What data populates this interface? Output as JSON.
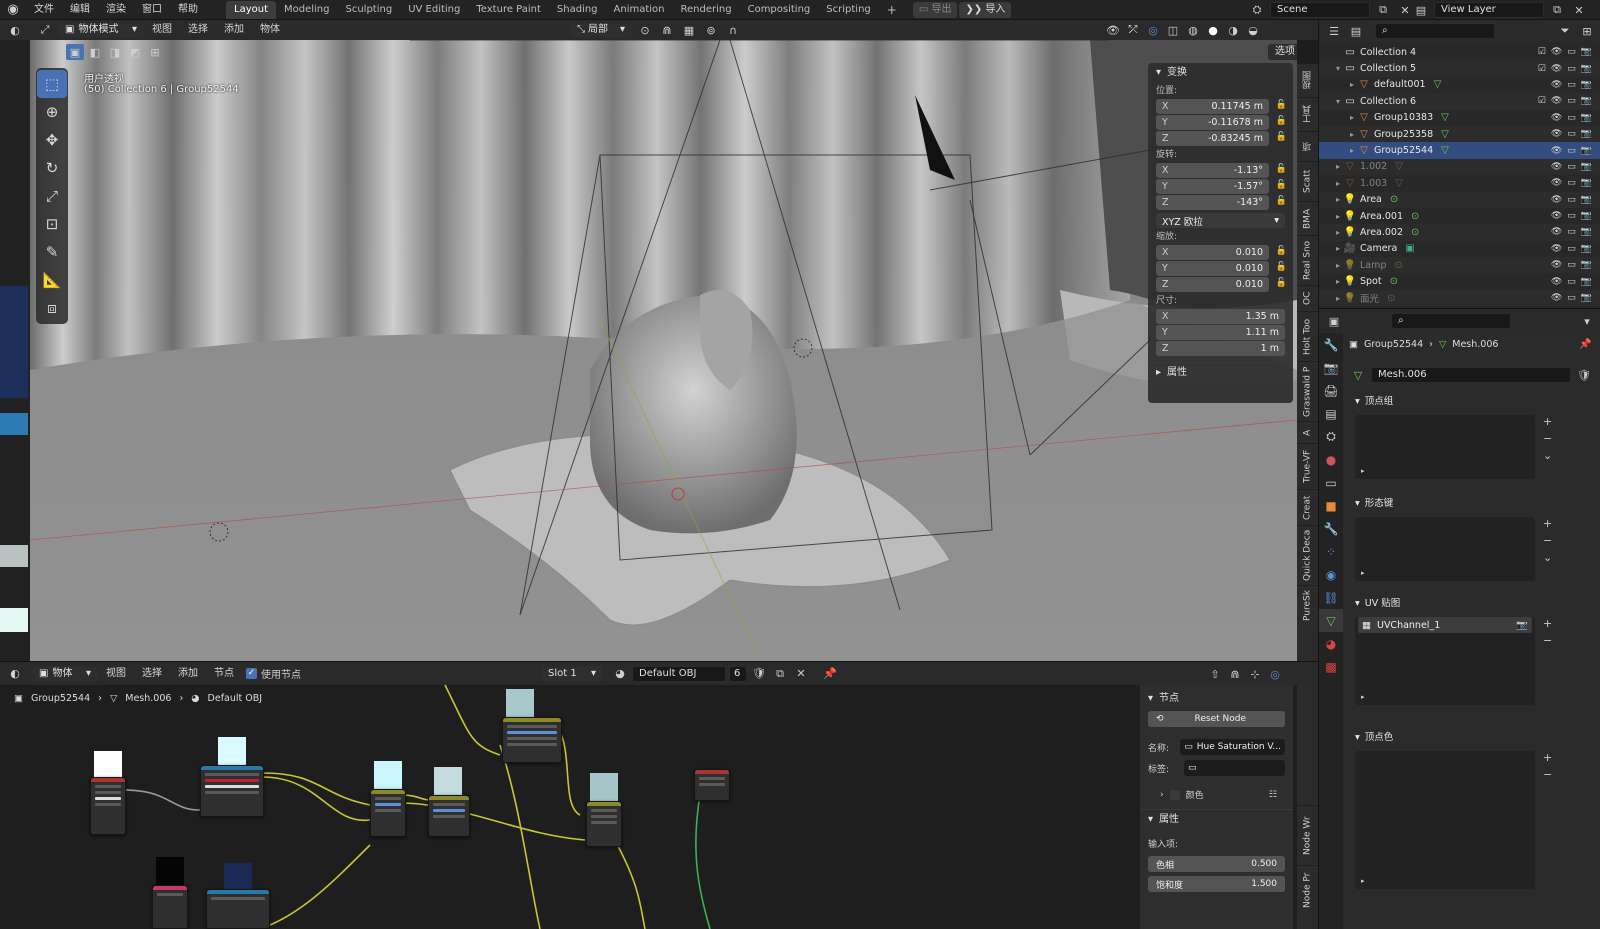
{
  "menubar": {
    "menus": [
      "文件",
      "编辑",
      "渲染",
      "窗口",
      "帮助"
    ],
    "workspaces": [
      "Layout",
      "Modeling",
      "Sculpting",
      "UV Editing",
      "Texture Paint",
      "Shading",
      "Animation",
      "Rendering",
      "Compositing",
      "Scripting"
    ],
    "active_workspace": "Layout",
    "add_tab": "+",
    "export_label": "导出",
    "import_label": "导入",
    "scene_name": "Scene",
    "view_layer": "View Layer"
  },
  "viewport_header": {
    "mode": "物体模式",
    "menus": [
      "视图",
      "选择",
      "添加",
      "物体"
    ],
    "transform_orientation": "局部",
    "options": "选项"
  },
  "viewport": {
    "view_name": "用户透视",
    "context": "(50) Collection 6 | Group52544"
  },
  "npanel": {
    "section_transform": "变换",
    "location_label": "位置:",
    "location": [
      {
        "axis": "X",
        "value": "0.11745 m"
      },
      {
        "axis": "Y",
        "value": "-0.11678 m"
      },
      {
        "axis": "Z",
        "value": "-0.83245 m"
      }
    ],
    "rotation_label": "旋转:",
    "rotation": [
      {
        "axis": "X",
        "value": "-1.13°"
      },
      {
        "axis": "Y",
        "value": "-1.57°"
      },
      {
        "axis": "Z",
        "value": "-143°"
      }
    ],
    "rotation_mode": "XYZ 欧拉",
    "scale_label": "缩放:",
    "scale": [
      {
        "axis": "X",
        "value": "0.010"
      },
      {
        "axis": "Y",
        "value": "0.010"
      },
      {
        "axis": "Z",
        "value": "0.010"
      }
    ],
    "dimensions_label": "尺寸:",
    "dimensions": [
      {
        "axis": "X",
        "value": "1.35 m"
      },
      {
        "axis": "Y",
        "value": "1.11 m"
      },
      {
        "axis": "Z",
        "value": "1 m"
      }
    ],
    "section_properties": "属性"
  },
  "side_tabs": [
    "视图",
    "工具",
    "项",
    "Scatt",
    "BMA",
    "Real Sno",
    "OC",
    "Holt Too",
    "Graswald P",
    "A",
    "True-VF",
    "Creat",
    "Quick Deca",
    "PureSk"
  ],
  "outliner": {
    "rows": [
      {
        "name": "Collection 4",
        "type": "collection",
        "indent": 0,
        "caret": "",
        "check": true
      },
      {
        "name": "Collection 5",
        "type": "collection",
        "indent": 0,
        "caret": "▾",
        "check": true
      },
      {
        "name": "default001",
        "type": "mesh",
        "indent": 1,
        "caret": "▸",
        "check": false
      },
      {
        "name": "Collection 6",
        "type": "collection",
        "indent": 0,
        "caret": "▾",
        "check": true
      },
      {
        "name": "Group10383",
        "type": "mesh",
        "indent": 1,
        "caret": "▸",
        "check": false
      },
      {
        "name": "Group25358",
        "type": "mesh",
        "indent": 1,
        "caret": "▸",
        "check": false
      },
      {
        "name": "Group52544",
        "type": "mesh",
        "indent": 1,
        "caret": "▸",
        "check": false
      },
      {
        "name": "1.002",
        "type": "mesh-dim",
        "indent": 0,
        "caret": "▸",
        "check": false
      },
      {
        "name": "1.003",
        "type": "mesh-dim",
        "indent": 0,
        "caret": "▸",
        "check": false
      },
      {
        "name": "Area",
        "type": "light",
        "indent": 0,
        "caret": "▸",
        "check": false
      },
      {
        "name": "Area.001",
        "type": "light",
        "indent": 0,
        "caret": "▸",
        "check": false
      },
      {
        "name": "Area.002",
        "type": "light",
        "indent": 0,
        "caret": "▸",
        "check": false
      },
      {
        "name": "Camera",
        "type": "camera",
        "indent": 0,
        "caret": "▸",
        "check": false
      },
      {
        "name": "Lamp",
        "type": "light-dim",
        "indent": 0,
        "caret": "▸",
        "check": false
      },
      {
        "name": "Spot",
        "type": "light",
        "indent": 0,
        "caret": "▸",
        "check": false
      },
      {
        "name": "面光",
        "type": "light-dim",
        "indent": 0,
        "caret": "▸",
        "check": false
      }
    ]
  },
  "properties": {
    "breadcrumb_object": "Group52544",
    "breadcrumb_mesh": "Mesh.006",
    "mesh_name": "Mesh.006",
    "sections": {
      "vertex_groups": "顶点组",
      "shape_keys": "形态键",
      "uv_maps": "UV 贴图",
      "vertex_colors": "顶点色"
    },
    "uv_channel": "UVChannel_1"
  },
  "node_header": {
    "editor_type": "物体",
    "menus": [
      "视图",
      "选择",
      "添加",
      "节点"
    ],
    "use_nodes": "使用节点",
    "slot": "Slot 1",
    "material": "Default OBJ",
    "users": "6"
  },
  "node_breadcrumb": {
    "object": "Group52544",
    "mesh": "Mesh.006",
    "material": "Default OBJ"
  },
  "node_npanel": {
    "section_node": "节点",
    "reset_node": "Reset Node",
    "name_label": "名称:",
    "name_value": "Hue Saturation V...",
    "label_label": "标签:",
    "label_value": "",
    "color_label": "颜色",
    "section_properties": "属性",
    "inputs_label": "输入项:",
    "hue_label": "色相",
    "hue_value": "0.500",
    "saturation_label": "饱和度",
    "saturation_value": "1.500"
  },
  "node_sidetabs": [
    "Node Wr",
    "Node Pr"
  ]
}
